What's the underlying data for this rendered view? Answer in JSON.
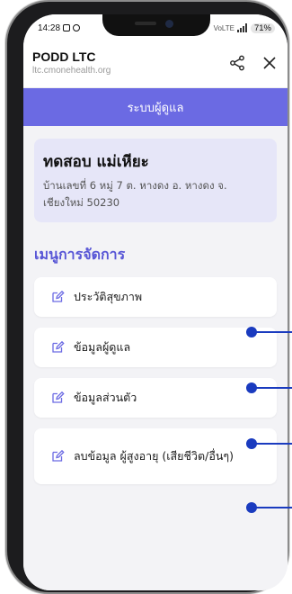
{
  "statusbar": {
    "time": "14:28",
    "battery": "71%",
    "signal_label": "VoLTE"
  },
  "appbar": {
    "title": "PODD LTC",
    "url": "ltc.cmonehealth.org",
    "share_icon": "share-icon",
    "close_icon": "close-icon"
  },
  "page": {
    "title": "ระบบผู้ดูแล"
  },
  "person": {
    "name": "ทดสอบ แม่เหียะ",
    "address": "บ้านเลขที่ 6 หมู่ 7 ต. หางดง อ. หางดง จ. เชียงใหม่ 50230"
  },
  "menu": {
    "title": "เมนูการจัดการ",
    "items": [
      {
        "label": "ประวัติสุขภาพ",
        "icon": "edit-icon"
      },
      {
        "label": "ข้อมูลผู้ดูแล",
        "icon": "edit-icon"
      },
      {
        "label": "ข้อมูลส่วนตัว",
        "icon": "edit-icon"
      },
      {
        "label": "ลบข้อมูล ผู้สูงอายุ (เสียชีวิต/อื่นๆ)",
        "icon": "edit-icon"
      }
    ]
  },
  "colors": {
    "primary": "#6b6ae3",
    "section_title": "#5856d6",
    "card_bg": "#e6e6f8",
    "callout": "#1a3bbf"
  }
}
